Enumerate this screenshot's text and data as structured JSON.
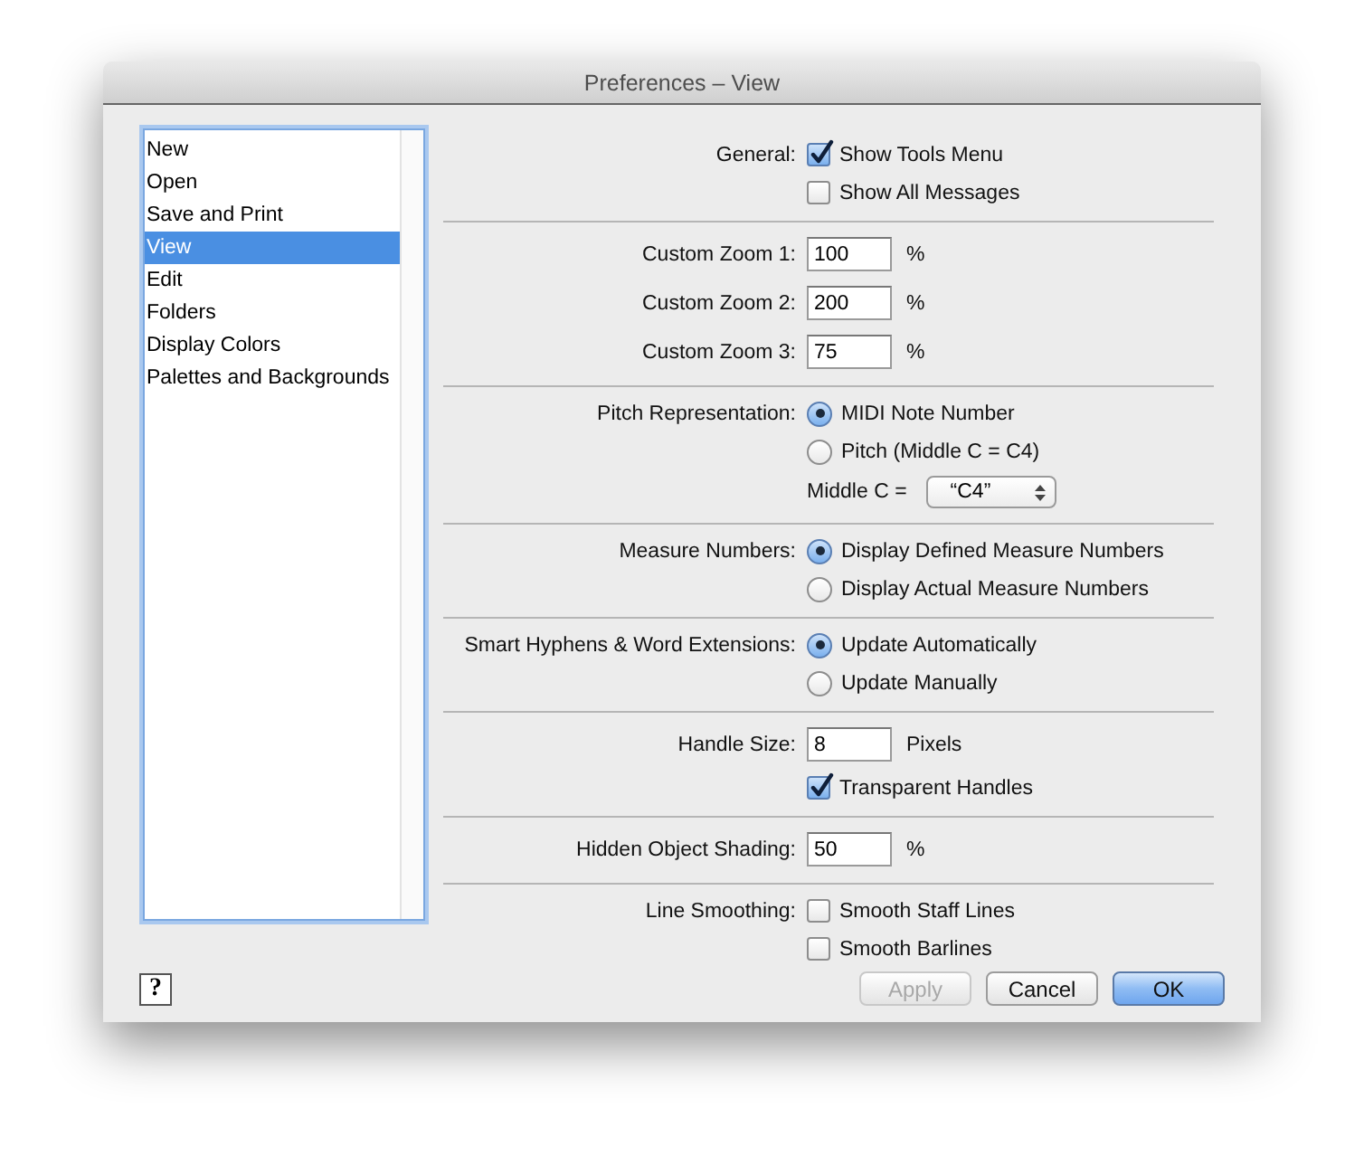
{
  "window": {
    "title": "Preferences – View"
  },
  "categories": [
    {
      "label": "New",
      "selected": false
    },
    {
      "label": "Open",
      "selected": false
    },
    {
      "label": "Save and Print",
      "selected": false
    },
    {
      "label": "View",
      "selected": true
    },
    {
      "label": "Edit",
      "selected": false
    },
    {
      "label": "Folders",
      "selected": false
    },
    {
      "label": "Display Colors",
      "selected": false
    },
    {
      "label": "Palettes and Backgrounds",
      "selected": false
    }
  ],
  "sections": [
    {
      "rows": [
        {
          "label": "General:",
          "kind": "checkbox",
          "text": "Show Tools Menu",
          "checked": true
        },
        {
          "kind": "checkbox",
          "text": "Show All Messages",
          "checked": false
        }
      ]
    },
    {
      "rows": [
        {
          "label": "Custom Zoom 1:",
          "kind": "field",
          "value": "100",
          "unit": "%"
        },
        {
          "label": "Custom Zoom 2:",
          "kind": "field",
          "value": "200",
          "unit": "%"
        },
        {
          "label": "Custom Zoom 3:",
          "kind": "field",
          "value": "75",
          "unit": "%"
        }
      ]
    },
    {
      "rows": [
        {
          "label": "Pitch Representation:",
          "kind": "radio",
          "text": "MIDI Note Number",
          "selected": true
        },
        {
          "kind": "radio",
          "text": "Pitch (Middle C = C4)",
          "selected": false
        },
        {
          "kind": "dropdown",
          "text": "Middle C =",
          "value": "“C4”"
        }
      ]
    },
    {
      "rows": [
        {
          "label": "Measure Numbers:",
          "kind": "radio",
          "text": "Display Defined Measure Numbers",
          "selected": true
        },
        {
          "kind": "radio",
          "text": "Display Actual Measure Numbers",
          "selected": false
        }
      ]
    },
    {
      "rows": [
        {
          "label": "Smart Hyphens & Word Extensions:",
          "kind": "radio",
          "text": "Update Automatically",
          "selected": true
        },
        {
          "kind": "radio",
          "text": "Update Manually",
          "selected": false
        }
      ]
    },
    {
      "rows": [
        {
          "label": "Handle Size:",
          "kind": "field",
          "value": "8",
          "unit": "Pixels"
        },
        {
          "kind": "checkbox",
          "text": "Transparent Handles",
          "checked": true
        }
      ]
    },
    {
      "rows": [
        {
          "label": "Hidden Object Shading:",
          "kind": "field",
          "value": "50",
          "unit": "%"
        }
      ]
    },
    {
      "rows": [
        {
          "label": "Line Smoothing:",
          "kind": "checkbox",
          "text": "Smooth Staff Lines",
          "checked": false
        },
        {
          "kind": "checkbox",
          "text": "Smooth Barlines",
          "checked": false
        }
      ]
    }
  ],
  "help_button": "?",
  "buttons": [
    {
      "label": "Apply",
      "disabled": true,
      "default": false
    },
    {
      "label": "Cancel",
      "disabled": false,
      "default": false
    },
    {
      "label": "OK",
      "disabled": false,
      "default": true
    }
  ]
}
